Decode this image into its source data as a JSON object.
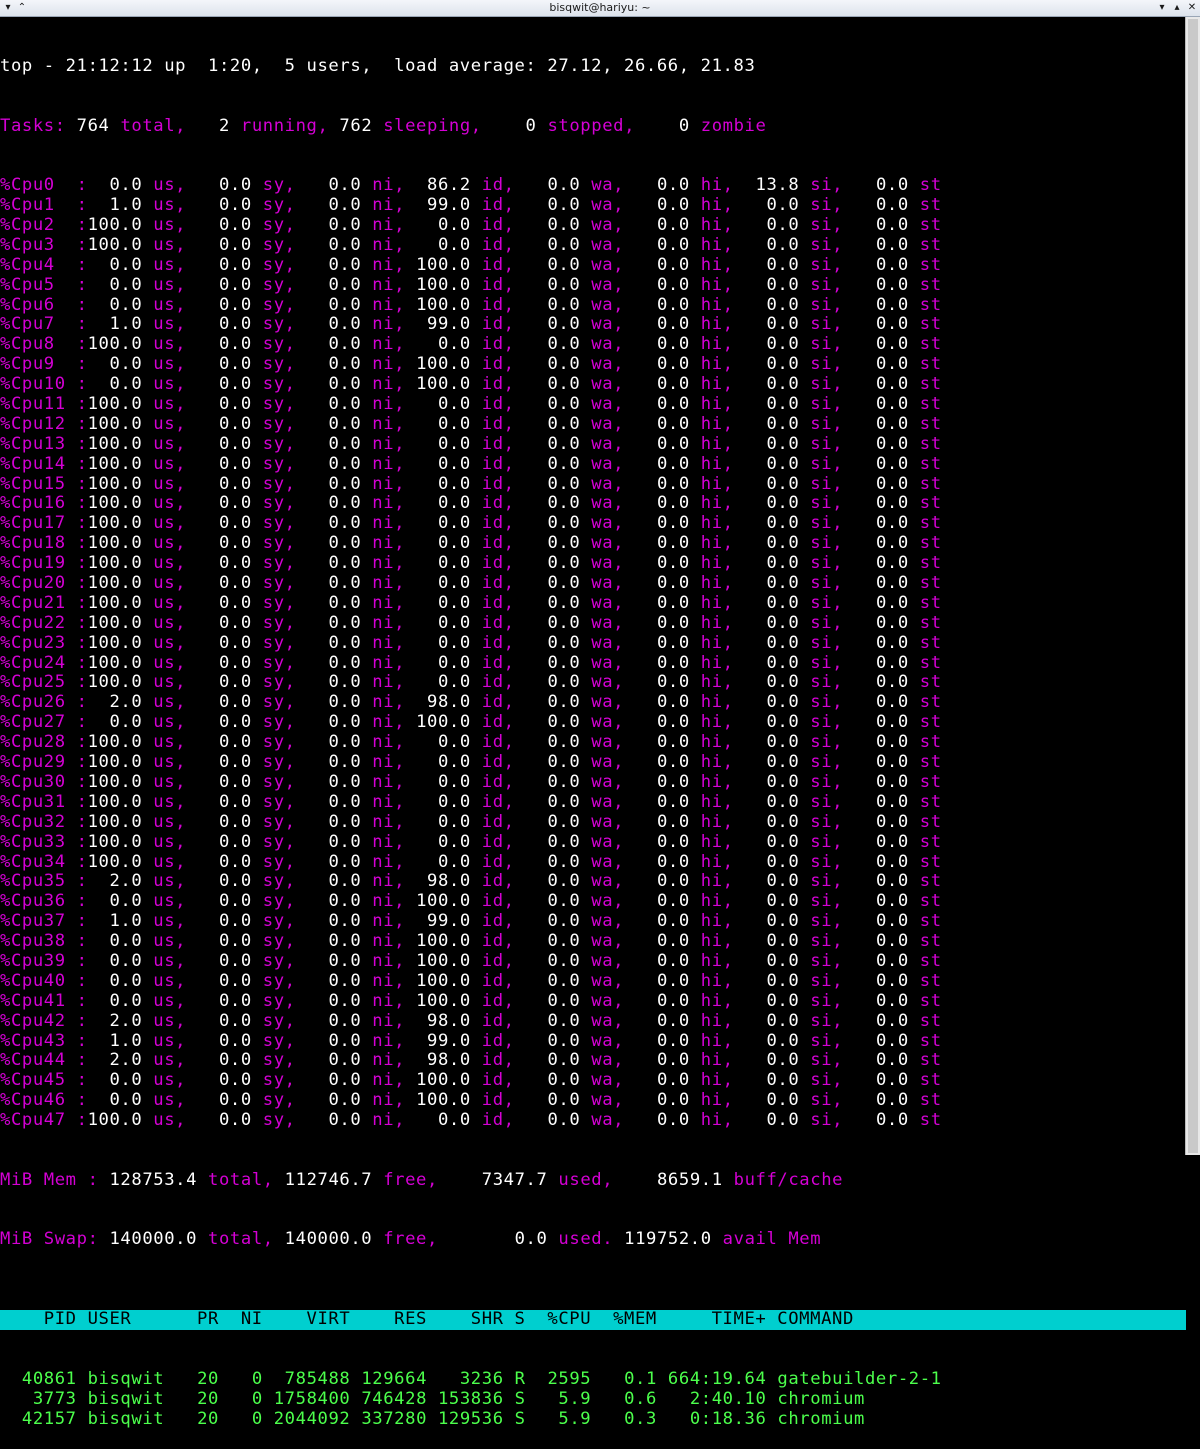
{
  "window": {
    "title": "bisqwit@hariyu: ~",
    "left_buttons": [
      "▾",
      "⌃"
    ],
    "right_buttons": [
      "▾",
      "▴",
      "✕"
    ]
  },
  "top": {
    "header_line": "top - 21:12:12 up  1:20,  5 users,  load average: 27.12, 26.66, 21.83",
    "tasks": {
      "label": "Tasks:",
      "total": "764",
      "total_label": "total,",
      "running": "2",
      "running_label": "running,",
      "sleeping": "762",
      "sleeping_label": "sleeping,",
      "stopped": "0",
      "stopped_label": "stopped,",
      "zombie": "0",
      "zombie_label": "zombie"
    },
    "cpus": [
      {
        "n": "%Cpu0  :",
        "us": "  0.0",
        "sy": "  0.0",
        "ni": "  0.0",
        "id": " 86.2",
        "wa": "  0.0",
        "hi": "  0.0",
        "si": " 13.8",
        "st": "  0.0"
      },
      {
        "n": "%Cpu1  :",
        "us": "  1.0",
        "sy": "  0.0",
        "ni": "  0.0",
        "id": " 99.0",
        "wa": "  0.0",
        "hi": "  0.0",
        "si": "  0.0",
        "st": "  0.0"
      },
      {
        "n": "%Cpu2  :",
        "us": "100.0",
        "sy": "  0.0",
        "ni": "  0.0",
        "id": "  0.0",
        "wa": "  0.0",
        "hi": "  0.0",
        "si": "  0.0",
        "st": "  0.0"
      },
      {
        "n": "%Cpu3  :",
        "us": "100.0",
        "sy": "  0.0",
        "ni": "  0.0",
        "id": "  0.0",
        "wa": "  0.0",
        "hi": "  0.0",
        "si": "  0.0",
        "st": "  0.0"
      },
      {
        "n": "%Cpu4  :",
        "us": "  0.0",
        "sy": "  0.0",
        "ni": "  0.0",
        "id": "100.0",
        "wa": "  0.0",
        "hi": "  0.0",
        "si": "  0.0",
        "st": "  0.0"
      },
      {
        "n": "%Cpu5  :",
        "us": "  0.0",
        "sy": "  0.0",
        "ni": "  0.0",
        "id": "100.0",
        "wa": "  0.0",
        "hi": "  0.0",
        "si": "  0.0",
        "st": "  0.0"
      },
      {
        "n": "%Cpu6  :",
        "us": "  0.0",
        "sy": "  0.0",
        "ni": "  0.0",
        "id": "100.0",
        "wa": "  0.0",
        "hi": "  0.0",
        "si": "  0.0",
        "st": "  0.0"
      },
      {
        "n": "%Cpu7  :",
        "us": "  1.0",
        "sy": "  0.0",
        "ni": "  0.0",
        "id": " 99.0",
        "wa": "  0.0",
        "hi": "  0.0",
        "si": "  0.0",
        "st": "  0.0"
      },
      {
        "n": "%Cpu8  :",
        "us": "100.0",
        "sy": "  0.0",
        "ni": "  0.0",
        "id": "  0.0",
        "wa": "  0.0",
        "hi": "  0.0",
        "si": "  0.0",
        "st": "  0.0"
      },
      {
        "n": "%Cpu9  :",
        "us": "  0.0",
        "sy": "  0.0",
        "ni": "  0.0",
        "id": "100.0",
        "wa": "  0.0",
        "hi": "  0.0",
        "si": "  0.0",
        "st": "  0.0"
      },
      {
        "n": "%Cpu10 :",
        "us": "  0.0",
        "sy": "  0.0",
        "ni": "  0.0",
        "id": "100.0",
        "wa": "  0.0",
        "hi": "  0.0",
        "si": "  0.0",
        "st": "  0.0"
      },
      {
        "n": "%Cpu11 :",
        "us": "100.0",
        "sy": "  0.0",
        "ni": "  0.0",
        "id": "  0.0",
        "wa": "  0.0",
        "hi": "  0.0",
        "si": "  0.0",
        "st": "  0.0"
      },
      {
        "n": "%Cpu12 :",
        "us": "100.0",
        "sy": "  0.0",
        "ni": "  0.0",
        "id": "  0.0",
        "wa": "  0.0",
        "hi": "  0.0",
        "si": "  0.0",
        "st": "  0.0"
      },
      {
        "n": "%Cpu13 :",
        "us": "100.0",
        "sy": "  0.0",
        "ni": "  0.0",
        "id": "  0.0",
        "wa": "  0.0",
        "hi": "  0.0",
        "si": "  0.0",
        "st": "  0.0"
      },
      {
        "n": "%Cpu14 :",
        "us": "100.0",
        "sy": "  0.0",
        "ni": "  0.0",
        "id": "  0.0",
        "wa": "  0.0",
        "hi": "  0.0",
        "si": "  0.0",
        "st": "  0.0"
      },
      {
        "n": "%Cpu15 :",
        "us": "100.0",
        "sy": "  0.0",
        "ni": "  0.0",
        "id": "  0.0",
        "wa": "  0.0",
        "hi": "  0.0",
        "si": "  0.0",
        "st": "  0.0"
      },
      {
        "n": "%Cpu16 :",
        "us": "100.0",
        "sy": "  0.0",
        "ni": "  0.0",
        "id": "  0.0",
        "wa": "  0.0",
        "hi": "  0.0",
        "si": "  0.0",
        "st": "  0.0"
      },
      {
        "n": "%Cpu17 :",
        "us": "100.0",
        "sy": "  0.0",
        "ni": "  0.0",
        "id": "  0.0",
        "wa": "  0.0",
        "hi": "  0.0",
        "si": "  0.0",
        "st": "  0.0"
      },
      {
        "n": "%Cpu18 :",
        "us": "100.0",
        "sy": "  0.0",
        "ni": "  0.0",
        "id": "  0.0",
        "wa": "  0.0",
        "hi": "  0.0",
        "si": "  0.0",
        "st": "  0.0"
      },
      {
        "n": "%Cpu19 :",
        "us": "100.0",
        "sy": "  0.0",
        "ni": "  0.0",
        "id": "  0.0",
        "wa": "  0.0",
        "hi": "  0.0",
        "si": "  0.0",
        "st": "  0.0"
      },
      {
        "n": "%Cpu20 :",
        "us": "100.0",
        "sy": "  0.0",
        "ni": "  0.0",
        "id": "  0.0",
        "wa": "  0.0",
        "hi": "  0.0",
        "si": "  0.0",
        "st": "  0.0"
      },
      {
        "n": "%Cpu21 :",
        "us": "100.0",
        "sy": "  0.0",
        "ni": "  0.0",
        "id": "  0.0",
        "wa": "  0.0",
        "hi": "  0.0",
        "si": "  0.0",
        "st": "  0.0"
      },
      {
        "n": "%Cpu22 :",
        "us": "100.0",
        "sy": "  0.0",
        "ni": "  0.0",
        "id": "  0.0",
        "wa": "  0.0",
        "hi": "  0.0",
        "si": "  0.0",
        "st": "  0.0"
      },
      {
        "n": "%Cpu23 :",
        "us": "100.0",
        "sy": "  0.0",
        "ni": "  0.0",
        "id": "  0.0",
        "wa": "  0.0",
        "hi": "  0.0",
        "si": "  0.0",
        "st": "  0.0"
      },
      {
        "n": "%Cpu24 :",
        "us": "100.0",
        "sy": "  0.0",
        "ni": "  0.0",
        "id": "  0.0",
        "wa": "  0.0",
        "hi": "  0.0",
        "si": "  0.0",
        "st": "  0.0"
      },
      {
        "n": "%Cpu25 :",
        "us": "100.0",
        "sy": "  0.0",
        "ni": "  0.0",
        "id": "  0.0",
        "wa": "  0.0",
        "hi": "  0.0",
        "si": "  0.0",
        "st": "  0.0"
      },
      {
        "n": "%Cpu26 :",
        "us": "  2.0",
        "sy": "  0.0",
        "ni": "  0.0",
        "id": " 98.0",
        "wa": "  0.0",
        "hi": "  0.0",
        "si": "  0.0",
        "st": "  0.0"
      },
      {
        "n": "%Cpu27 :",
        "us": "  0.0",
        "sy": "  0.0",
        "ni": "  0.0",
        "id": "100.0",
        "wa": "  0.0",
        "hi": "  0.0",
        "si": "  0.0",
        "st": "  0.0"
      },
      {
        "n": "%Cpu28 :",
        "us": "100.0",
        "sy": "  0.0",
        "ni": "  0.0",
        "id": "  0.0",
        "wa": "  0.0",
        "hi": "  0.0",
        "si": "  0.0",
        "st": "  0.0"
      },
      {
        "n": "%Cpu29 :",
        "us": "100.0",
        "sy": "  0.0",
        "ni": "  0.0",
        "id": "  0.0",
        "wa": "  0.0",
        "hi": "  0.0",
        "si": "  0.0",
        "st": "  0.0"
      },
      {
        "n": "%Cpu30 :",
        "us": "100.0",
        "sy": "  0.0",
        "ni": "  0.0",
        "id": "  0.0",
        "wa": "  0.0",
        "hi": "  0.0",
        "si": "  0.0",
        "st": "  0.0"
      },
      {
        "n": "%Cpu31 :",
        "us": "100.0",
        "sy": "  0.0",
        "ni": "  0.0",
        "id": "  0.0",
        "wa": "  0.0",
        "hi": "  0.0",
        "si": "  0.0",
        "st": "  0.0"
      },
      {
        "n": "%Cpu32 :",
        "us": "100.0",
        "sy": "  0.0",
        "ni": "  0.0",
        "id": "  0.0",
        "wa": "  0.0",
        "hi": "  0.0",
        "si": "  0.0",
        "st": "  0.0"
      },
      {
        "n": "%Cpu33 :",
        "us": "100.0",
        "sy": "  0.0",
        "ni": "  0.0",
        "id": "  0.0",
        "wa": "  0.0",
        "hi": "  0.0",
        "si": "  0.0",
        "st": "  0.0"
      },
      {
        "n": "%Cpu34 :",
        "us": "100.0",
        "sy": "  0.0",
        "ni": "  0.0",
        "id": "  0.0",
        "wa": "  0.0",
        "hi": "  0.0",
        "si": "  0.0",
        "st": "  0.0"
      },
      {
        "n": "%Cpu35 :",
        "us": "  2.0",
        "sy": "  0.0",
        "ni": "  0.0",
        "id": " 98.0",
        "wa": "  0.0",
        "hi": "  0.0",
        "si": "  0.0",
        "st": "  0.0"
      },
      {
        "n": "%Cpu36 :",
        "us": "  0.0",
        "sy": "  0.0",
        "ni": "  0.0",
        "id": "100.0",
        "wa": "  0.0",
        "hi": "  0.0",
        "si": "  0.0",
        "st": "  0.0"
      },
      {
        "n": "%Cpu37 :",
        "us": "  1.0",
        "sy": "  0.0",
        "ni": "  0.0",
        "id": " 99.0",
        "wa": "  0.0",
        "hi": "  0.0",
        "si": "  0.0",
        "st": "  0.0"
      },
      {
        "n": "%Cpu38 :",
        "us": "  0.0",
        "sy": "  0.0",
        "ni": "  0.0",
        "id": "100.0",
        "wa": "  0.0",
        "hi": "  0.0",
        "si": "  0.0",
        "st": "  0.0"
      },
      {
        "n": "%Cpu39 :",
        "us": "  0.0",
        "sy": "  0.0",
        "ni": "  0.0",
        "id": "100.0",
        "wa": "  0.0",
        "hi": "  0.0",
        "si": "  0.0",
        "st": "  0.0"
      },
      {
        "n": "%Cpu40 :",
        "us": "  0.0",
        "sy": "  0.0",
        "ni": "  0.0",
        "id": "100.0",
        "wa": "  0.0",
        "hi": "  0.0",
        "si": "  0.0",
        "st": "  0.0"
      },
      {
        "n": "%Cpu41 :",
        "us": "  0.0",
        "sy": "  0.0",
        "ni": "  0.0",
        "id": "100.0",
        "wa": "  0.0",
        "hi": "  0.0",
        "si": "  0.0",
        "st": "  0.0"
      },
      {
        "n": "%Cpu42 :",
        "us": "  2.0",
        "sy": "  0.0",
        "ni": "  0.0",
        "id": " 98.0",
        "wa": "  0.0",
        "hi": "  0.0",
        "si": "  0.0",
        "st": "  0.0"
      },
      {
        "n": "%Cpu43 :",
        "us": "  1.0",
        "sy": "  0.0",
        "ni": "  0.0",
        "id": " 99.0",
        "wa": "  0.0",
        "hi": "  0.0",
        "si": "  0.0",
        "st": "  0.0"
      },
      {
        "n": "%Cpu44 :",
        "us": "  2.0",
        "sy": "  0.0",
        "ni": "  0.0",
        "id": " 98.0",
        "wa": "  0.0",
        "hi": "  0.0",
        "si": "  0.0",
        "st": "  0.0"
      },
      {
        "n": "%Cpu45 :",
        "us": "  0.0",
        "sy": "  0.0",
        "ni": "  0.0",
        "id": "100.0",
        "wa": "  0.0",
        "hi": "  0.0",
        "si": "  0.0",
        "st": "  0.0"
      },
      {
        "n": "%Cpu46 :",
        "us": "  0.0",
        "sy": "  0.0",
        "ni": "  0.0",
        "id": "100.0",
        "wa": "  0.0",
        "hi": "  0.0",
        "si": "  0.0",
        "st": "  0.0"
      },
      {
        "n": "%Cpu47 :",
        "us": "100.0",
        "sy": "  0.0",
        "ni": "  0.0",
        "id": "  0.0",
        "wa": "  0.0",
        "hi": "  0.0",
        "si": "  0.0",
        "st": "  0.0"
      }
    ],
    "mem_line": {
      "label": "MiB Mem :",
      "total": "128753.4",
      "total_label": "total,",
      "free": "112746.7",
      "free_label": "free,",
      "used": "  7347.7",
      "used_label": "used,",
      "buff": "  8659.1",
      "buff_label": "buff/cache"
    },
    "swap_line": {
      "label": "MiB Swap:",
      "total": "140000.0",
      "total_label": "total,",
      "free": "140000.0",
      "free_label": "free,",
      "used": "     0.0",
      "used_label": "used.",
      "avail": "119752.0",
      "avail_label": "avail Mem"
    },
    "columns_header": "    PID USER      PR  NI    VIRT    RES    SHR S  %CPU  %MEM     TIME+ COMMAND",
    "processes": [
      {
        "pid": "  40861",
        "user": "bisqwit ",
        "pr": " 20",
        "ni": "  0",
        "virt": " 785488",
        "res": "129664",
        "shr": "  3236",
        "s": "R",
        "cpu": " 2595",
        "mem": "  0.1",
        "time": "664:19.64",
        "cmd": "gatebuilder-2-1"
      },
      {
        "pid": "   3773",
        "user": "bisqwit ",
        "pr": " 20",
        "ni": "  0",
        "virt": "1758400",
        "res": "746428",
        "shr": "153836",
        "s": "S",
        "cpu": "  5.9",
        "mem": "  0.6",
        "time": "  2:40.10",
        "cmd": "chromium"
      },
      {
        "pid": "  42157",
        "user": "bisqwit ",
        "pr": " 20",
        "ni": "  0",
        "virt": "2044092",
        "res": "337280",
        "shr": "129536",
        "s": "S",
        "cpu": "  5.9",
        "mem": "  0.3",
        "time": "  0:18.36",
        "cmd": "chromium"
      }
    ]
  },
  "colors": {
    "background": "#000000",
    "label_magenta": "#d400d4",
    "value_white": "#ffffff",
    "header_cyan": "#00cfcf",
    "process_green": "#4cff4c"
  }
}
